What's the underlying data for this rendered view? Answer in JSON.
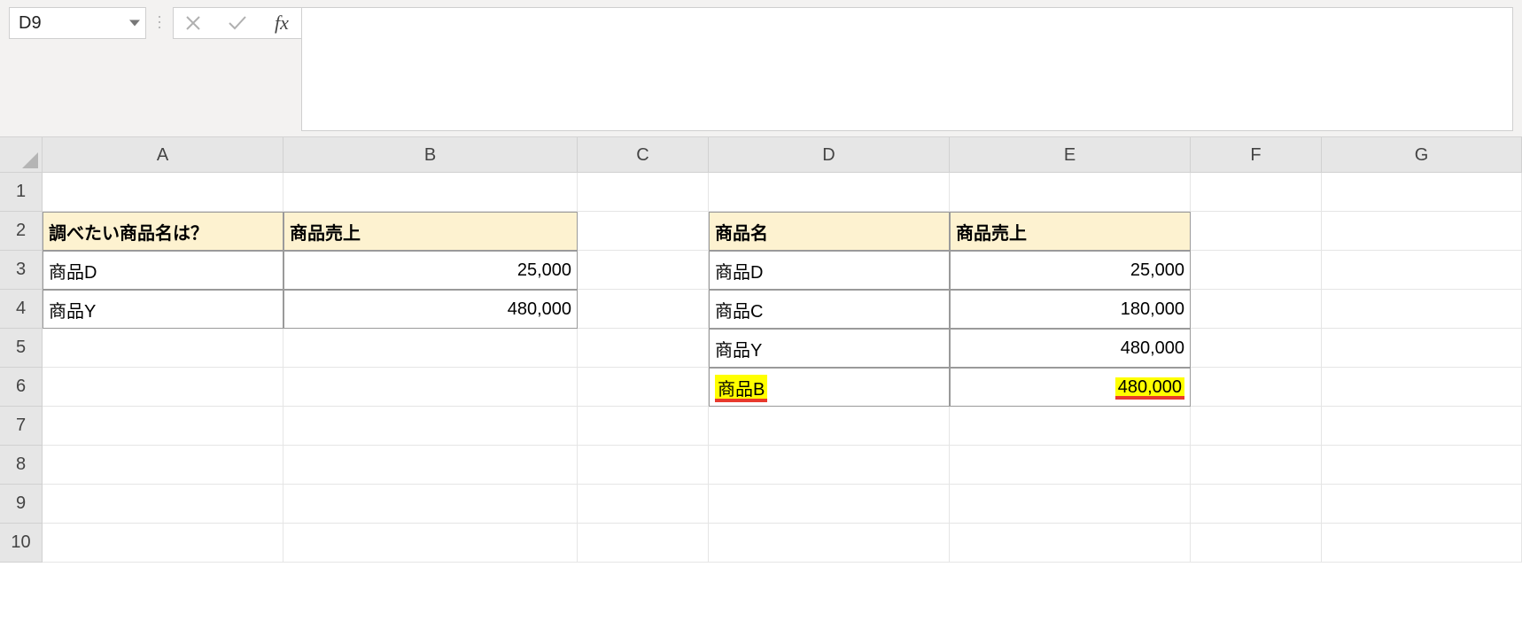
{
  "name_box": {
    "value": "D9"
  },
  "formula_bar": {
    "value": ""
  },
  "fx_label": "fx",
  "columns": [
    "A",
    "B",
    "C",
    "D",
    "E",
    "F",
    "G"
  ],
  "rows": [
    "1",
    "2",
    "3",
    "4",
    "5",
    "6",
    "7",
    "8",
    "9",
    "10"
  ],
  "left_table": {
    "headers": {
      "a": "調べたい商品名は？",
      "b": "商品売上"
    },
    "rows": [
      {
        "name": "商品D",
        "sales": "25,000"
      },
      {
        "name": "商品Y",
        "sales": "480,000"
      }
    ]
  },
  "right_table": {
    "headers": {
      "d": "商品名",
      "e": "商品売上"
    },
    "rows": [
      {
        "name": "商品D",
        "sales": "25,000",
        "hl": false
      },
      {
        "name": "商品C",
        "sales": "180,000",
        "hl": false
      },
      {
        "name": "商品Y",
        "sales": "480,000",
        "hl": false
      },
      {
        "name": "商品B",
        "sales": "480,000",
        "hl": true
      }
    ]
  }
}
